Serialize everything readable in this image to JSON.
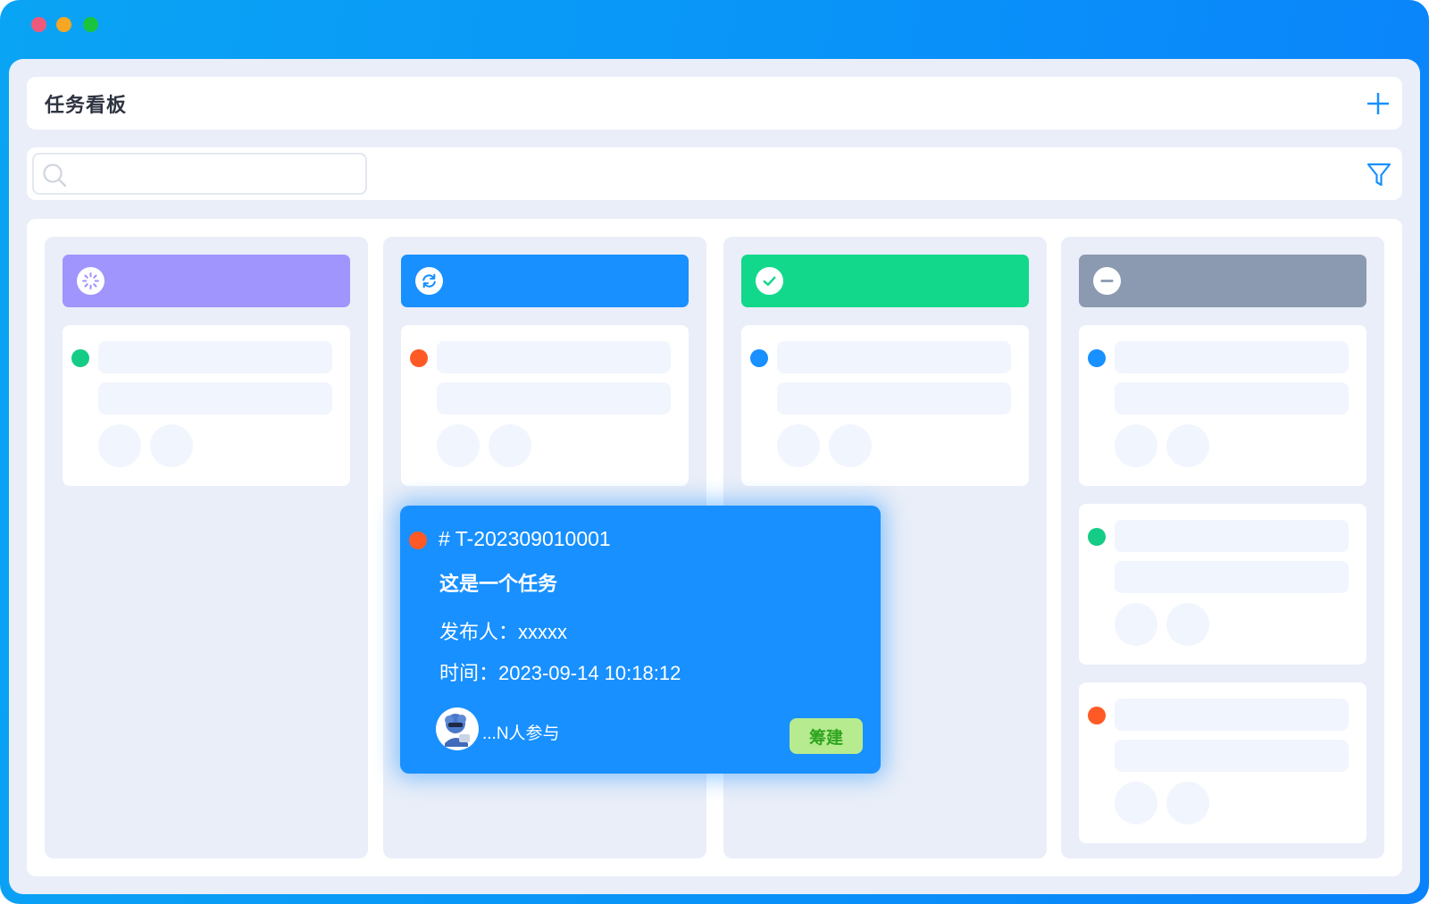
{
  "header": {
    "title": "任务看板",
    "add_icon": "plus-icon"
  },
  "toolbar": {
    "search_value": "",
    "search_placeholder": "",
    "search_icon": "search-icon",
    "filter_icon": "filter-icon"
  },
  "columns": [
    {
      "status_icon": "loading-icon",
      "color": "#a094fd",
      "card_dots": [
        "#14cc85"
      ]
    },
    {
      "status_icon": "refresh-icon",
      "color": "#1890ff",
      "card_dots": [
        "#ff5a26"
      ]
    },
    {
      "status_icon": "check-icon",
      "color": "#12d88c",
      "card_dots": [
        "#1890ff"
      ]
    },
    {
      "status_icon": "minus-icon",
      "color": "#8b9ab0",
      "card_dots": [
        "#1890ff",
        "#14cc85",
        "#ff5a26"
      ]
    }
  ],
  "drag_card": {
    "task_id": "# T-202309010001",
    "title": "这是一个任务",
    "publisher_label": "发布人：",
    "publisher_value": "xxxxx",
    "time_label": "时间：",
    "time_value": "2023-09-14 10:18:12",
    "participants": "...N人参与",
    "tag": "筹建",
    "priority_color": "#ff5a26",
    "tag_color": "#b7eb8f"
  }
}
